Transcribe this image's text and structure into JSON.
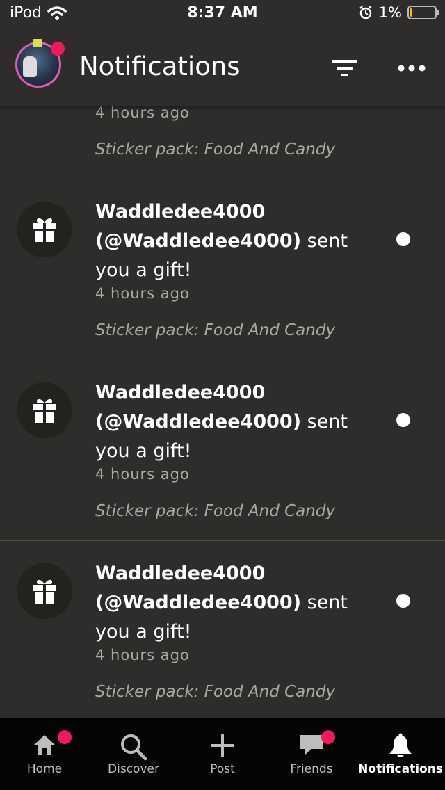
{
  "status_bar": {
    "carrier": "iPod",
    "time": "8:37 AM",
    "battery": "1%",
    "battery_level": 0.01
  },
  "header": {
    "title": "Notifications",
    "filter_icon": "filter-icon",
    "more_icon": "more-dots-icon"
  },
  "notifications": [
    {
      "user": "",
      "message": "",
      "time": "4 hours ago",
      "detail": "Sticker pack: Food And Candy"
    },
    {
      "user": "Waddledee4000 (@Waddledee4000)",
      "message": " sent you a gift!",
      "time": "4 hours ago",
      "detail": "Sticker pack: Food And Candy",
      "icon": "gift-icon",
      "unread": true
    },
    {
      "user": "Waddledee4000 (@Waddledee4000)",
      "message": " sent you a gift!",
      "time": "4 hours ago",
      "detail": "Sticker pack: Food And Candy",
      "icon": "gift-icon",
      "unread": true
    },
    {
      "user": "Waddledee4000 (@Waddledee4000)",
      "message": " sent you a gift!",
      "time": "4 hours ago",
      "detail": "Sticker pack: Food And Candy",
      "icon": "gift-icon",
      "unread": true
    }
  ],
  "tabs": [
    {
      "label": "Home",
      "icon": "home-icon",
      "badge": true,
      "active": false
    },
    {
      "label": "Discover",
      "icon": "search-icon",
      "badge": false,
      "active": false
    },
    {
      "label": "Post",
      "icon": "plus-icon",
      "badge": false,
      "active": false
    },
    {
      "label": "Friends",
      "icon": "chat-icon",
      "badge": true,
      "active": false
    },
    {
      "label": "Notifications",
      "icon": "bell-icon",
      "badge": false,
      "active": true
    }
  ],
  "colors": {
    "background": "#2e2d2b",
    "accent_badge": "#f0195c",
    "tabbar": "#050505"
  }
}
